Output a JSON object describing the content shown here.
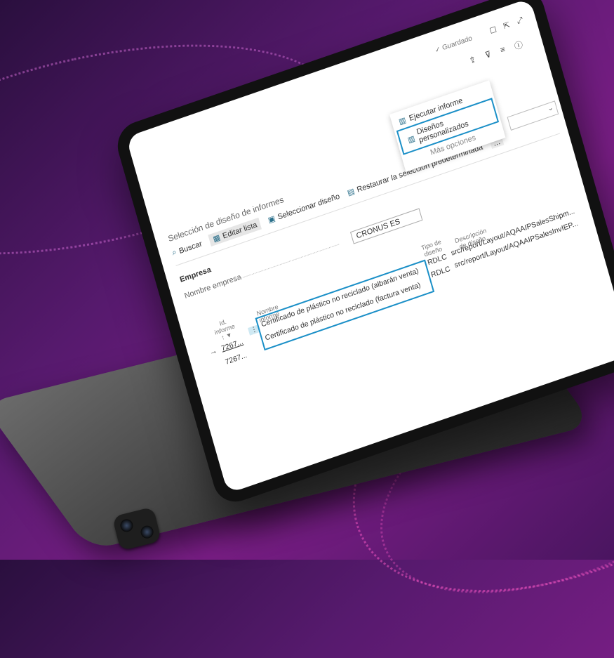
{
  "header": {
    "saved_label": "✓ Guardado",
    "page_title": "Selección de diseño de informes"
  },
  "toolbar": {
    "search_label": "Buscar",
    "edit_list_label": "Editar lista",
    "select_layout_label": "Seleccionar diseño",
    "restore_label": "Restaurar la selección predeterminada",
    "more_label": "..."
  },
  "dropdown": {
    "items": [
      {
        "label": "Ejecutar informe"
      },
      {
        "label": "Diseños personalizados"
      },
      {
        "label": "Más opciones"
      }
    ]
  },
  "company": {
    "section_label": "Empresa",
    "name_label": "Nombre empresa",
    "name_value": "CRONUS ES"
  },
  "table": {
    "col_id": "Id. informe",
    "col_name": "Nombre informe",
    "col_type": "Tipo de diseño",
    "col_desc": "Descripción de diseño",
    "sort_glyph": "↑",
    "rows": [
      {
        "id": "7267...",
        "name": "Certificado de plástico no reciclado (albarán venta)",
        "type": "RDLC",
        "desc": "src/report/Layout/AQAAIPSalesShipm..."
      },
      {
        "id": "7267...",
        "name": "Certificado de plástico no reciclado (factura venta)",
        "type": "RDLC",
        "desc": "src/report/Layout/AQAAIPSalesInvIEP..."
      }
    ]
  },
  "icons": {
    "search": "search-icon",
    "edit_list": "edit-list-icon",
    "select_layout": "select-layout-icon",
    "restore": "restore-icon",
    "bookmark": "bookmark-icon",
    "share": "share-icon",
    "expand": "expand-icon",
    "filter": "filter-icon",
    "list": "list-icon",
    "info": "info-icon"
  },
  "colors": {
    "highlight": "#1a8fc7",
    "background_start": "#2a0f3e",
    "background_end": "#7a1e86"
  }
}
